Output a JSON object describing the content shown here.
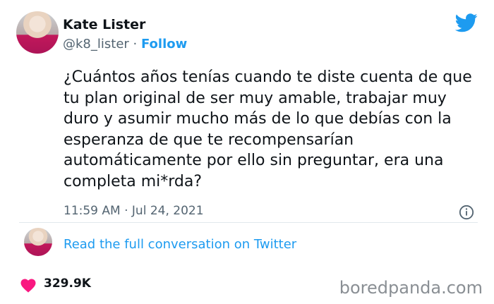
{
  "tweet": {
    "author_name": "Kate Lister",
    "handle": "@k8_lister",
    "separator": " · ",
    "follow_label": "Follow",
    "text": "¿Cuántos años tenías cuando te diste cuenta de que tu plan original de ser muy amable, trabajar muy duro y asumir mucho más de lo que debías con la esperanza de que te recompensarían automáticamente por ello sin preguntar, era una completa mi*rda?",
    "timestamp": "11:59 AM · Jul 24, 2021",
    "conversation_link": "Read the full conversation on Twitter",
    "like_count": "329.9K"
  },
  "watermark": "boredpanda.com",
  "colors": {
    "twitter_blue": "#1d9bf0",
    "heart_red": "#f91880",
    "text_primary": "#0f1419",
    "text_secondary": "#536471"
  },
  "icons": [
    "twitter-bird-icon",
    "info-icon",
    "heart-icon"
  ]
}
